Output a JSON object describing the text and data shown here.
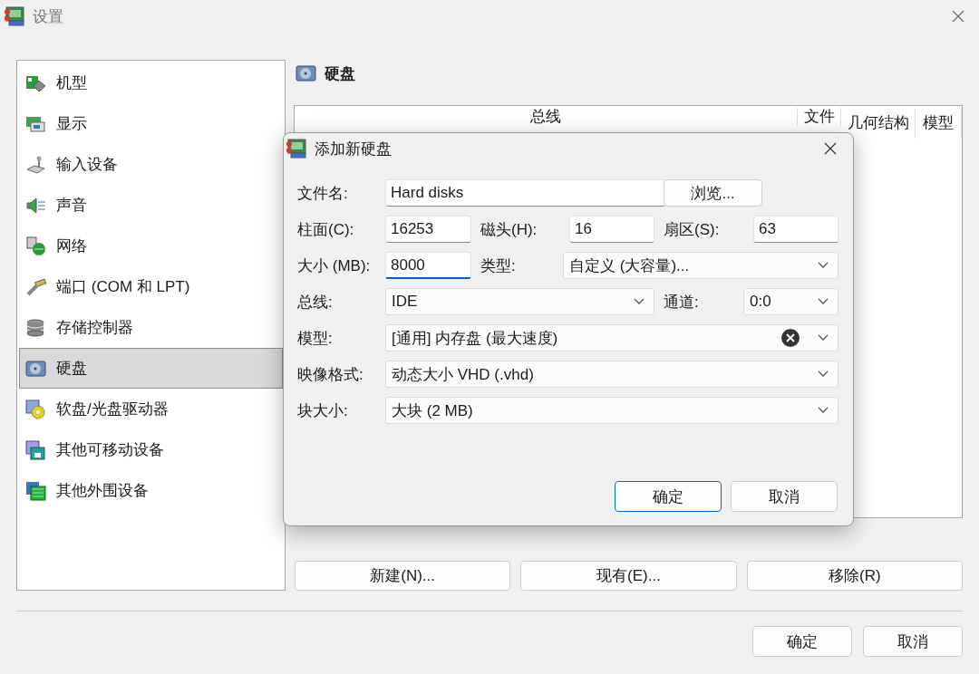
{
  "window": {
    "title": "设置"
  },
  "sidebar": {
    "items": [
      {
        "label": "机型",
        "selected": false
      },
      {
        "label": "显示",
        "selected": false
      },
      {
        "label": "输入设备",
        "selected": false
      },
      {
        "label": "声音",
        "selected": false
      },
      {
        "label": "网络",
        "selected": false
      },
      {
        "label": "端口 (COM 和 LPT)",
        "selected": false
      },
      {
        "label": "存储控制器",
        "selected": false
      },
      {
        "label": "硬盘",
        "selected": true
      },
      {
        "label": "软盘/光盘驱动器",
        "selected": false
      },
      {
        "label": "其他可移动设备",
        "selected": false
      },
      {
        "label": "其他外围设备",
        "selected": false
      }
    ]
  },
  "section": {
    "title": "硬盘"
  },
  "table": {
    "columns": [
      "总线",
      "文件",
      "几何结构",
      "模型"
    ]
  },
  "disk_buttons": [
    "新建(N)...",
    "现有(E)...",
    "移除(R)"
  ],
  "buttons": [
    "确定",
    "取消"
  ],
  "dialog": {
    "title": "添加新硬盘",
    "rows": [
      [
        {
          "kind": "label",
          "text": "文件名:"
        },
        {
          "kind": "input",
          "value": "Hard disks",
          "focused": false
        },
        {
          "kind": "button",
          "text": "浏览..."
        }
      ],
      [
        {
          "kind": "label",
          "text": "柱面(C):"
        },
        {
          "kind": "input",
          "value": "16253",
          "focused": false
        },
        {
          "kind": "label",
          "text": "磁头(H):"
        },
        {
          "kind": "input",
          "value": "16",
          "focused": false
        },
        {
          "kind": "label",
          "text": "扇区(S):"
        },
        {
          "kind": "input",
          "value": "63",
          "focused": false
        }
      ],
      [
        {
          "kind": "label",
          "text": "大小 (MB):"
        },
        {
          "kind": "input",
          "value": "8000",
          "focused": true
        },
        {
          "kind": "label",
          "text": "类型:"
        },
        {
          "kind": "select",
          "value": "自定义 (大容量)...",
          "clearable": false
        }
      ],
      [
        {
          "kind": "label",
          "text": "总线:"
        },
        {
          "kind": "select",
          "value": "IDE",
          "clearable": false
        },
        "",
        "",
        {
          "kind": "label",
          "text": "通道:"
        },
        {
          "kind": "select",
          "value": "0:0",
          "clearable": false
        }
      ],
      [
        {
          "kind": "label",
          "text": "模型:"
        },
        {
          "kind": "select",
          "value": "[通用] 内存盘 (最大速度)",
          "clearable": true
        }
      ],
      [
        {
          "kind": "label",
          "text": "映像格式:"
        },
        {
          "kind": "select",
          "value": "动态大小 VHD (.vhd)",
          "clearable": false
        }
      ],
      [
        {
          "kind": "label",
          "text": "块大小:"
        },
        {
          "kind": "select",
          "value": "大块 (2 MB)",
          "clearable": false
        }
      ]
    ],
    "buttons": [
      {
        "label": "确定",
        "default": true
      },
      {
        "label": "取消",
        "default": false
      }
    ]
  }
}
